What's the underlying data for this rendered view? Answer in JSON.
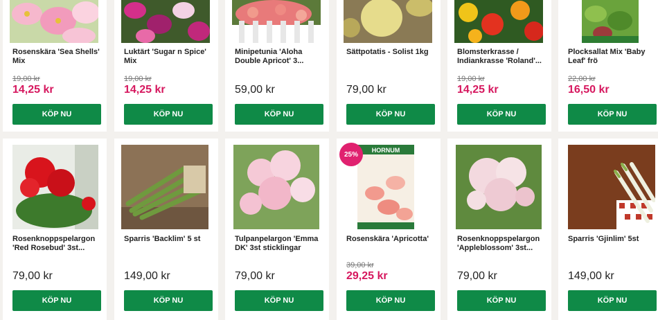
{
  "products": [
    {
      "name": "Rosenskära 'Sea Shells' Mix",
      "old_price": "19,00 kr",
      "price": "14,25 kr",
      "buy": "KÖP NU"
    },
    {
      "name": "Luktärt 'Sugar n Spice' Mix",
      "old_price": "19,00 kr",
      "price": "14,25 kr",
      "buy": "KÖP NU"
    },
    {
      "name": "Minipetunia 'Aloha Double Apricot' 3...",
      "price": "59,00 kr",
      "buy": "KÖP NU"
    },
    {
      "name": "Sättpotatis - Solist 1kg",
      "price": "79,00 kr",
      "buy": "KÖP NU"
    },
    {
      "name": "Blomsterkrasse / Indiankrasse 'Roland'...",
      "old_price": "19,00 kr",
      "price": "14,25 kr",
      "buy": "KÖP NU"
    },
    {
      "name": "Plocksallat Mix 'Baby Leaf' frö",
      "old_price": "22,00 kr",
      "price": "16,50 kr",
      "buy": "KÖP NU"
    },
    {
      "name": "Rosenknoppspelargon 'Red Rosebud' 3st...",
      "price": "79,00 kr",
      "buy": "KÖP NU"
    },
    {
      "name": "Sparris 'Backlim' 5 st",
      "price": "149,00 kr",
      "buy": "KÖP NU"
    },
    {
      "name": "Tulpanpelargon 'Emma DK' 3st sticklingar",
      "price": "79,00 kr",
      "buy": "KÖP NU"
    },
    {
      "name": "Rosenskära 'Apricotta'",
      "badge": "25%",
      "old_price": "39,00 kr",
      "price": "29,25 kr",
      "buy": "KÖP NU",
      "packet_brand": "HORNUM"
    },
    {
      "name": "Rosenknoppspelargon 'Appleblossom' 3st...",
      "price": "79,00 kr",
      "buy": "KÖP NU"
    },
    {
      "name": "Sparris 'Gjinlim' 5st",
      "price": "149,00 kr",
      "buy": "KÖP NU"
    }
  ],
  "colors": {
    "sale": "#d6175e",
    "button": "#0f8a47",
    "badge": "#e0216f"
  }
}
